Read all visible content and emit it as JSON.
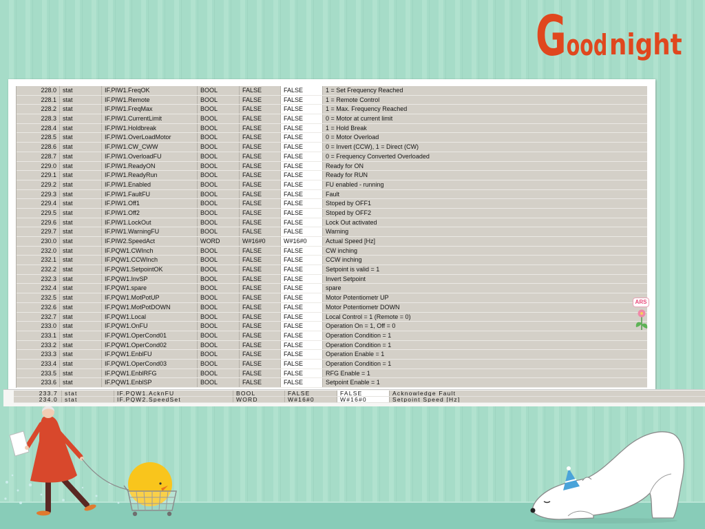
{
  "greeting": {
    "word1": "Good",
    "word2": "night"
  },
  "sign": {
    "text": "ARS"
  },
  "colors": {
    "wallpaper": "#a6dcc8",
    "wallpaper_stripe": "#b1e2cf",
    "ground": "#88ccb8",
    "greeting": "#e0471e",
    "table_cell": "#d4d0c8",
    "table_cell_editable": "#ffffff",
    "coat": "#d8482c",
    "chick": "#f9c51c",
    "party_hat": "#4aa3d9"
  },
  "table": {
    "rows": [
      {
        "address": "228.0",
        "decl": "stat",
        "name": "IF.PIW1.FreqOK",
        "type": "BOOL",
        "initial": "FALSE",
        "actual": "FALSE",
        "comment": "1 = Set Frequency Reached"
      },
      {
        "address": "228.1",
        "decl": "stat",
        "name": "IF.PIW1.Remote",
        "type": "BOOL",
        "initial": "FALSE",
        "actual": "FALSE",
        "comment": "1 = Remote Control"
      },
      {
        "address": "228.2",
        "decl": "stat",
        "name": "IF.PIW1.FreqMax",
        "type": "BOOL",
        "initial": "FALSE",
        "actual": "FALSE",
        "comment": "1 = Max. Frequency Reached"
      },
      {
        "address": "228.3",
        "decl": "stat",
        "name": "IF.PIW1.CurrentLimit",
        "type": "BOOL",
        "initial": "FALSE",
        "actual": "FALSE",
        "comment": "0 = Motor at current limit"
      },
      {
        "address": "228.4",
        "decl": "stat",
        "name": "IF.PIW1.Holdbreak",
        "type": "BOOL",
        "initial": "FALSE",
        "actual": "FALSE",
        "comment": "1 = Hold Break"
      },
      {
        "address": "228.5",
        "decl": "stat",
        "name": "IF.PIW1.OverLoadMotor",
        "type": "BOOL",
        "initial": "FALSE",
        "actual": "FALSE",
        "comment": "0 = Motor Overload"
      },
      {
        "address": "228.6",
        "decl": "stat",
        "name": "IF.PIW1.CW_CWW",
        "type": "BOOL",
        "initial": "FALSE",
        "actual": "FALSE",
        "comment": "0 = Invert (CCW), 1 = Direct (CW)"
      },
      {
        "address": "228.7",
        "decl": "stat",
        "name": "IF.PIW1.OverloadFU",
        "type": "BOOL",
        "initial": "FALSE",
        "actual": "FALSE",
        "comment": "0 = Frequency Converted Overloaded"
      },
      {
        "address": "229.0",
        "decl": "stat",
        "name": "IF.PIW1.ReadyON",
        "type": "BOOL",
        "initial": "FALSE",
        "actual": "FALSE",
        "comment": "Ready for ON"
      },
      {
        "address": "229.1",
        "decl": "stat",
        "name": "IF.PIW1.ReadyRun",
        "type": "BOOL",
        "initial": "FALSE",
        "actual": "FALSE",
        "comment": "Ready for RUN"
      },
      {
        "address": "229.2",
        "decl": "stat",
        "name": "IF.PIW1.Enabled",
        "type": "BOOL",
        "initial": "FALSE",
        "actual": "FALSE",
        "comment": "FU enabled - running"
      },
      {
        "address": "229.3",
        "decl": "stat",
        "name": "IF.PIW1.FaultFU",
        "type": "BOOL",
        "initial": "FALSE",
        "actual": "FALSE",
        "comment": "Fault"
      },
      {
        "address": "229.4",
        "decl": "stat",
        "name": "IF.PIW1.Off1",
        "type": "BOOL",
        "initial": "FALSE",
        "actual": "FALSE",
        "comment": "Stoped by OFF1"
      },
      {
        "address": "229.5",
        "decl": "stat",
        "name": "IF.PIW1.Off2",
        "type": "BOOL",
        "initial": "FALSE",
        "actual": "FALSE",
        "comment": "Stoped by OFF2"
      },
      {
        "address": "229.6",
        "decl": "stat",
        "name": "IF.PIW1.LockOut",
        "type": "BOOL",
        "initial": "FALSE",
        "actual": "FALSE",
        "comment": "Lock Out activated"
      },
      {
        "address": "229.7",
        "decl": "stat",
        "name": "IF.PIW1.WarningFU",
        "type": "BOOL",
        "initial": "FALSE",
        "actual": "FALSE",
        "comment": "Warning"
      },
      {
        "address": "230.0",
        "decl": "stat",
        "name": "IF.PIW2.SpeedAct",
        "type": "WORD",
        "initial": "W#16#0",
        "actual": "W#16#0",
        "comment": "Actual Speed [Hz]"
      },
      {
        "address": "232.0",
        "decl": "stat",
        "name": "IF.PQW1.CWInch",
        "type": "BOOL",
        "initial": "FALSE",
        "actual": "FALSE",
        "comment": "CW inching"
      },
      {
        "address": "232.1",
        "decl": "stat",
        "name": "IF.PQW1.CCWInch",
        "type": "BOOL",
        "initial": "FALSE",
        "actual": "FALSE",
        "comment": "CCW inching"
      },
      {
        "address": "232.2",
        "decl": "stat",
        "name": "IF.PQW1.SetpointOK",
        "type": "BOOL",
        "initial": "FALSE",
        "actual": "FALSE",
        "comment": "Setpoint is valid = 1"
      },
      {
        "address": "232.3",
        "decl": "stat",
        "name": "IF.PQW1.InvSP",
        "type": "BOOL",
        "initial": "FALSE",
        "actual": "FALSE",
        "comment": "Invert Setpoint"
      },
      {
        "address": "232.4",
        "decl": "stat",
        "name": "IF.PQW1.spare",
        "type": "BOOL",
        "initial": "FALSE",
        "actual": "FALSE",
        "comment": "spare"
      },
      {
        "address": "232.5",
        "decl": "stat",
        "name": "IF.PQW1.MotPotUP",
        "type": "BOOL",
        "initial": "FALSE",
        "actual": "FALSE",
        "comment": "Motor Potentiometr UP"
      },
      {
        "address": "232.6",
        "decl": "stat",
        "name": "IF.PQW1.MotPotDOWN",
        "type": "BOOL",
        "initial": "FALSE",
        "actual": "FALSE",
        "comment": "Motor Potentiometr DOWN"
      },
      {
        "address": "232.7",
        "decl": "stat",
        "name": "IF.PQW1.Local",
        "type": "BOOL",
        "initial": "FALSE",
        "actual": "FALSE",
        "comment": "Local Control = 1 (Remote = 0)"
      },
      {
        "address": "233.0",
        "decl": "stat",
        "name": "IF.PQW1.OnFU",
        "type": "BOOL",
        "initial": "FALSE",
        "actual": "FALSE",
        "comment": "Operation On = 1, Off = 0"
      },
      {
        "address": "233.1",
        "decl": "stat",
        "name": "IF.PQW1.OperCond01",
        "type": "BOOL",
        "initial": "FALSE",
        "actual": "FALSE",
        "comment": "Operation Condition = 1"
      },
      {
        "address": "233.2",
        "decl": "stat",
        "name": "IF.PQW1.OperCond02",
        "type": "BOOL",
        "initial": "FALSE",
        "actual": "FALSE",
        "comment": "Operation Condition = 1"
      },
      {
        "address": "233.3",
        "decl": "stat",
        "name": "IF.PQW1.EnblFU",
        "type": "BOOL",
        "initial": "FALSE",
        "actual": "FALSE",
        "comment": "Operation Enable = 1"
      },
      {
        "address": "233.4",
        "decl": "stat",
        "name": "IF.PQW1.OperCond03",
        "type": "BOOL",
        "initial": "FALSE",
        "actual": "FALSE",
        "comment": "Operation Condition = 1"
      },
      {
        "address": "233.5",
        "decl": "stat",
        "name": "IF.PQW1.EnblRFG",
        "type": "BOOL",
        "initial": "FALSE",
        "actual": "FALSE",
        "comment": "RFG Enable = 1"
      },
      {
        "address": "233.6",
        "decl": "stat",
        "name": "IF.PQW1.EnblSP",
        "type": "BOOL",
        "initial": "FALSE",
        "actual": "FALSE",
        "comment": "Setpoint Enable = 1"
      }
    ]
  },
  "table_continued": {
    "rows": [
      {
        "address": "233.7",
        "decl": "stat",
        "name": "IF.PQW1.AcknFU",
        "type": "BOOL",
        "initial": "FALSE",
        "actual": "FALSE",
        "comment": "Acknowledge Fault"
      },
      {
        "address": "234.0",
        "decl": "stat",
        "name": "IF.PQW2.SpeedSet",
        "type": "WORD",
        "initial": "W#16#0",
        "actual": "W#16#0",
        "comment": "Setpoint Speed [Hz]"
      }
    ]
  }
}
